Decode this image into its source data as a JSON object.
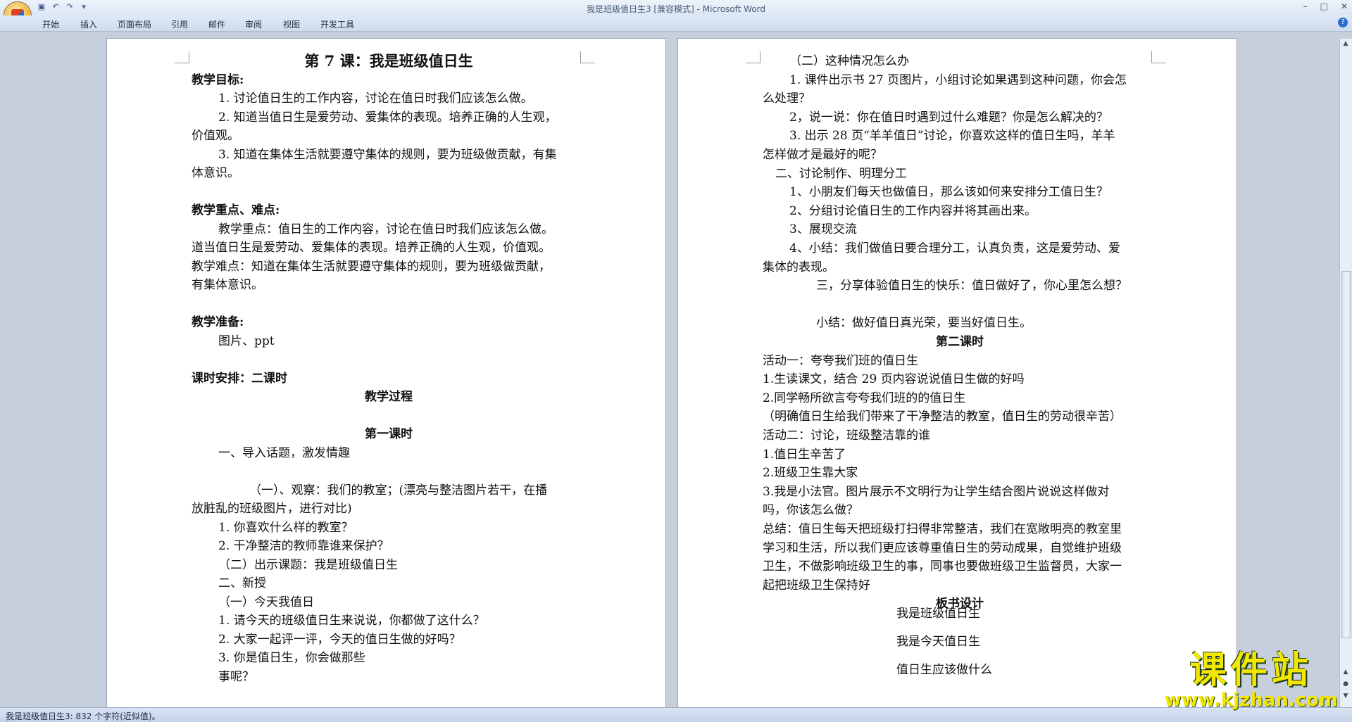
{
  "window": {
    "title": "我是班级值日生3 [兼容模式] - Microsoft Word",
    "controls": [
      "–",
      "□",
      "✕"
    ]
  },
  "ribbon": {
    "tabs": [
      "开始",
      "插入",
      "页面布局",
      "引用",
      "邮件",
      "审阅",
      "视图",
      "开发工具"
    ]
  },
  "left_page": {
    "lines": [
      {
        "t": "第 7 课：我是班级值日生",
        "style": "title"
      },
      {
        "t": "教学目标:",
        "style": "head"
      },
      {
        "t": "1. 讨论值日生的工作内容，讨论在值日时我们应该怎么做。",
        "style": "indent"
      },
      {
        "t": "2. 知道当值日生是爱劳动、爱集体的表现。培养正确的人生观，",
        "style": "indent"
      },
      {
        "t": "价值观。",
        "style": "plain"
      },
      {
        "t": "3. 知道在集体生活就要遵守集体的规则，要为班级做贡献，有集",
        "style": "indent"
      },
      {
        "t": "体意识。",
        "style": "plain"
      },
      {
        "t": "",
        "style": "plain"
      },
      {
        "t": "教学重点、难点:",
        "style": "head"
      },
      {
        "t": "教学重点：值日生的工作内容，讨论在值日时我们应该怎么做。",
        "style": "indent"
      },
      {
        "t": "道当值日生是爱劳动、爱集体的表现。培养正确的人生观，价值观。",
        "style": "plain"
      },
      {
        "t": "教学难点：知道在集体生活就要遵守集体的规则，要为班级做贡献，",
        "style": "plain"
      },
      {
        "t": "有集体意识。",
        "style": "plain"
      },
      {
        "t": "",
        "style": "plain"
      },
      {
        "t": "教学准备:",
        "style": "head"
      },
      {
        "t": "图片、ppt",
        "style": "indent"
      },
      {
        "t": "",
        "style": "plain"
      },
      {
        "t": "课时安排：二课时",
        "style": "headmix"
      },
      {
        "t": "教学过程",
        "style": "center"
      },
      {
        "t": "",
        "style": "center"
      },
      {
        "t": "第一课时",
        "style": "center"
      },
      {
        "t": "一、导入话题，激发情趣",
        "style": "indent"
      },
      {
        "t": "",
        "style": "indent"
      },
      {
        "t": "（一）、观察：我们的教室；(漂亮与整洁图片若干，在播",
        "style": "indent2"
      },
      {
        "t": "放脏乱的班级图片，进行对比)",
        "style": "plain"
      },
      {
        "t": "1. 你喜欢什么样的教室？",
        "style": "indent"
      },
      {
        "t": "2. 干净整洁的教师靠谁来保护？",
        "style": "indent"
      },
      {
        "t": "（二）出示课题：我是班级值日生",
        "style": "indent"
      },
      {
        "t": "二、新授",
        "style": "indent"
      },
      {
        "t": "（一）今天我值日",
        "style": "indent"
      },
      {
        "t": "1. 请今天的班级值日生来说说，你都做了这什么？",
        "style": "indent"
      },
      {
        "t": "2. 大家一起评一评，今天的值日生做的好吗？",
        "style": "indent"
      },
      {
        "t": "3. 你是值日生，你会做那些",
        "style": "indent"
      },
      {
        "t": "事呢？",
        "style": "indent"
      }
    ]
  },
  "right_page": {
    "lines": [
      {
        "t": "（二）这种情况怎么办",
        "style": "indent"
      },
      {
        "t": "1. 课件出示书 27 页图片，小组讨论如果遇到这种问题，你会怎",
        "style": "indent"
      },
      {
        "t": "么处理？",
        "style": "plain"
      },
      {
        "t": "2，说一说：你在值日时遇到过什么难题？你是怎么解决的？",
        "style": "indent"
      },
      {
        "t": "3. 出示 28 页“羊羊值日”讨论，你喜欢这样的值日生吗，羊羊",
        "style": "indent"
      },
      {
        "t": "怎样做才是最好的呢？",
        "style": "plain"
      },
      {
        "t": "二、讨论制作、明理分工",
        "style": "indent1"
      },
      {
        "t": "1、小朋友们每天也做值日，那么该如何来安排分工值日生？",
        "style": "indent"
      },
      {
        "t": "2、分组讨论值日生的工作内容并将其画出来。",
        "style": "indent"
      },
      {
        "t": "3、展现交流",
        "style": "indent"
      },
      {
        "t": "4、小结：我们做值日要合理分工，认真负责，这是爱劳动、爱",
        "style": "indent"
      },
      {
        "t": "集体的表现。",
        "style": "plain"
      },
      {
        "t": "三，分享体验值日生的快乐：值日做好了，你心里怎么想？",
        "style": "indent3"
      },
      {
        "t": "",
        "style": "indent"
      },
      {
        "t": "小结：做好值日真光荣，要当好值日生。",
        "style": "indent3"
      },
      {
        "t": "第二课时",
        "style": "center"
      },
      {
        "t": "活动一：夸夸我们班的值日生",
        "style": "plain"
      },
      {
        "t": "1.生读课文，结合 29 页内容说说值日生做的好吗",
        "style": "plain"
      },
      {
        "t": "2.同学畅所欲言夸夸我们班的的值日生",
        "style": "plain"
      },
      {
        "t": "（明确值日生给我们带来了干净整洁的教室，值日生的劳动很辛苦）",
        "style": "plain"
      },
      {
        "t": "活动二：讨论，班级整洁靠的谁",
        "style": "plain"
      },
      {
        "t": "1.值日生辛苦了",
        "style": "plain"
      },
      {
        "t": "2.班级卫生靠大家",
        "style": "plain"
      },
      {
        "t": "3.我是小法官。图片展示不文明行为让学生结合图片说说这样做对",
        "style": "plain"
      },
      {
        "t": "吗，你该怎么做？",
        "style": "plain"
      },
      {
        "t": "总结：值日生每天把班级打扫得非常整洁，我们在宽敞明亮的教室里",
        "style": "plain"
      },
      {
        "t": "学习和生活，所以我们更应该尊重值日生的劳动成果，自觉维护班级",
        "style": "plain"
      },
      {
        "t": "卫生，不做影响班级卫生的事，同事也要做班级卫生监督员，大家一",
        "style": "plain"
      },
      {
        "t": "起把班级卫生保持好",
        "style": "plain"
      },
      {
        "t": "板书设计",
        "style": "center"
      },
      {
        "t": "我是班级值日生",
        "style": "board"
      },
      {
        "t": "我是今天值日生",
        "style": "board"
      },
      {
        "t": "值日生应该做什么",
        "style": "board"
      }
    ]
  },
  "status": {
    "text": "我是班级值日生3: 832 个字符(近似值)。"
  },
  "watermark": {
    "big": "课件站",
    "small": "www.kjzhan.com"
  }
}
